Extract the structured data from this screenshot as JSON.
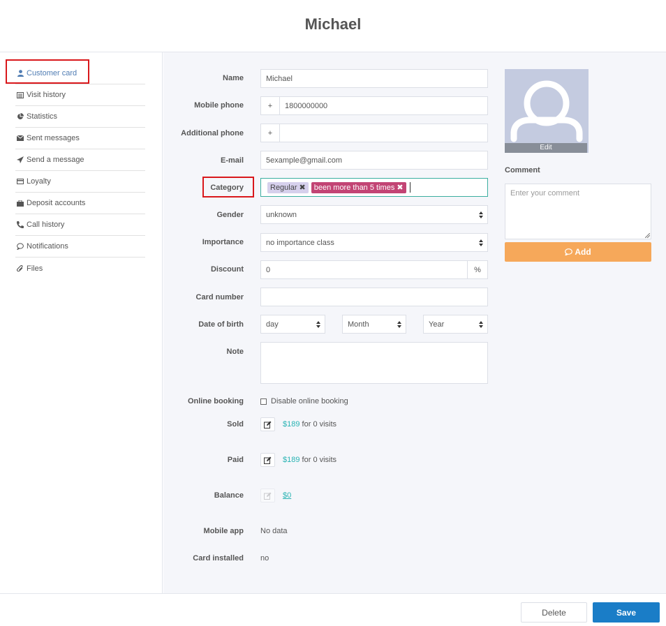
{
  "title": "Michael",
  "sidebar": {
    "items": [
      {
        "label": "Customer card",
        "icon": "user-icon"
      },
      {
        "label": "Visit history",
        "icon": "list-icon"
      },
      {
        "label": "Statistics",
        "icon": "pie-chart-icon"
      },
      {
        "label": "Sent messages",
        "icon": "envelope-icon"
      },
      {
        "label": "Send a message",
        "icon": "paper-plane-icon"
      },
      {
        "label": "Loyalty",
        "icon": "card-icon"
      },
      {
        "label": "Deposit accounts",
        "icon": "briefcase-icon"
      },
      {
        "label": "Call history",
        "icon": "phone-icon"
      },
      {
        "label": "Notifications",
        "icon": "chat-bubble-icon"
      },
      {
        "label": "Files",
        "icon": "paperclip-icon"
      }
    ]
  },
  "form": {
    "name": {
      "label": "Name",
      "value": "Michael"
    },
    "mobile_phone": {
      "label": "Mobile phone",
      "prefix": "+",
      "value": "1800000000"
    },
    "additional_phone": {
      "label": "Additional phone",
      "prefix": "+",
      "value": ""
    },
    "email": {
      "label": "E-mail",
      "value": "5example@gmail.com"
    },
    "category": {
      "label": "Category",
      "tags": [
        "Regular",
        "been more than 5 times"
      ]
    },
    "gender": {
      "label": "Gender",
      "value": "unknown"
    },
    "importance": {
      "label": "Importance",
      "value": "no importance class"
    },
    "discount": {
      "label": "Discount",
      "value": "0",
      "suffix": "%"
    },
    "card_number": {
      "label": "Card number",
      "value": ""
    },
    "date_of_birth": {
      "label": "Date of birth",
      "day": "day",
      "month": "Month",
      "year": "Year"
    },
    "note": {
      "label": "Note",
      "value": ""
    },
    "online_booking": {
      "label": "Online booking",
      "checkbox_label": "Disable online booking",
      "checked": false
    },
    "sold": {
      "label": "Sold",
      "amount": "$189",
      "suffix": "for 0 visits"
    },
    "paid": {
      "label": "Paid",
      "amount": "$189",
      "suffix": "for 0 visits"
    },
    "balance": {
      "label": "Balance",
      "amount": "$0"
    },
    "mobile_app": {
      "label": "Mobile app",
      "value": "No data"
    },
    "card_installed": {
      "label": "Card installed",
      "value": "no"
    }
  },
  "avatar": {
    "edit_label": "Edit"
  },
  "comment": {
    "label": "Comment",
    "placeholder": "Enter your comment",
    "add_label": "Add"
  },
  "footer": {
    "delete_label": "Delete",
    "save_label": "Save"
  },
  "colors": {
    "accent": "#1a7dc7",
    "add_button": "#f6a85a",
    "tag_regular": "#d6d0ec",
    "tag_been": "#c24474",
    "highlight": "#d9171b",
    "money": "#28b3b3"
  }
}
